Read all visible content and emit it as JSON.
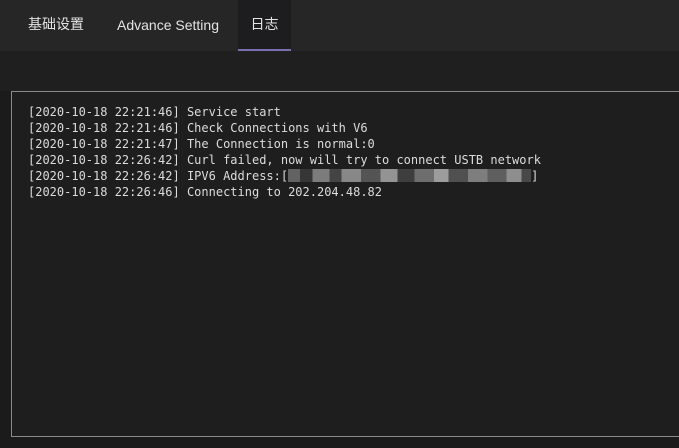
{
  "tabs": [
    {
      "label": "基础设置"
    },
    {
      "label": "Advance Setting"
    },
    {
      "label": "日志"
    }
  ],
  "log": {
    "lines": [
      "[2020-10-18 22:21:46] Service start",
      "[2020-10-18 22:21:46] Check Connections with V6",
      "[2020-10-18 22:21:47] The Connection is normal:0",
      "[2020-10-18 22:26:42] Curl failed, now will try to connect USTB network"
    ],
    "ipv6_line": {
      "prefix": "[2020-10-18 22:26:42] IPV6 Address:[",
      "suffix": "]"
    },
    "last_line": "[2020-10-18 22:26:46] Connecting to 202.204.48.82"
  },
  "colors": {
    "tab_indicator": "#7b6fb0",
    "background": "#1b1b1c",
    "text": "#dcdcdc"
  }
}
